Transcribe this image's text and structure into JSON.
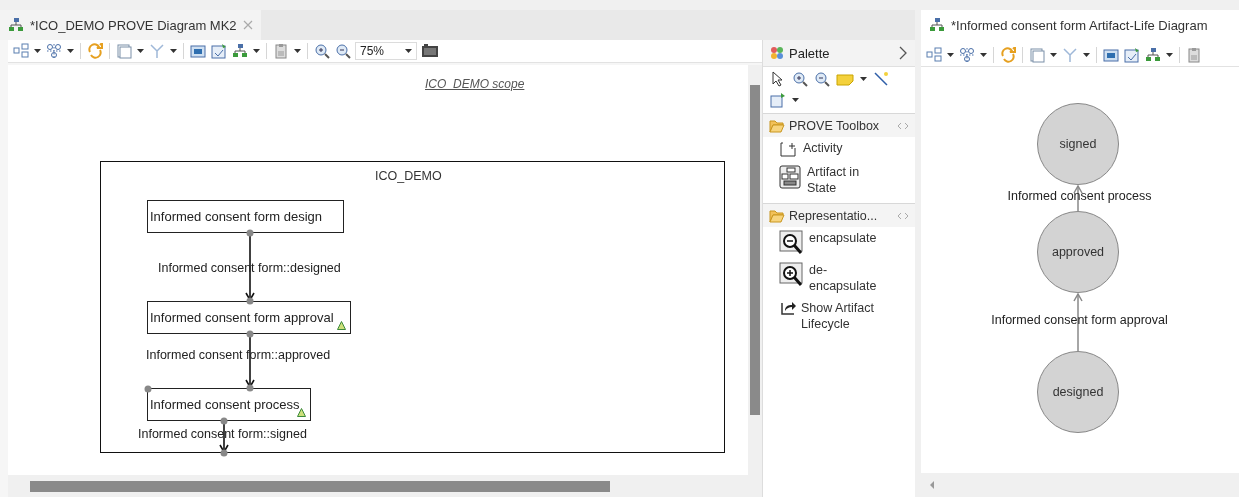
{
  "left_editor": {
    "tab": {
      "title": "*ICO_DEMO PROVE Diagram MK2",
      "closable": true
    },
    "zoom": "75%",
    "scope_label": "ICO_DEMO scope",
    "container": {
      "title": "ICO_DEMO"
    },
    "nodes": [
      {
        "label": "Informed consent form design",
        "badge": false
      },
      {
        "label": "Informed consent form approval",
        "badge": true
      },
      {
        "label": "Informed consent process",
        "badge": true
      }
    ],
    "edges": [
      {
        "label": "Informed consent form::designed"
      },
      {
        "label": "Informed consent form::approved"
      },
      {
        "label": "Informed consent form::signed"
      }
    ]
  },
  "palette": {
    "title": "Palette",
    "drawers": [
      {
        "title": "PROVE Toolbox",
        "expanded": true,
        "items": [
          {
            "kind": "activity",
            "label": "Activity"
          },
          {
            "kind": "artifact",
            "label": "Artifact in State"
          }
        ]
      },
      {
        "title": "Representatio...",
        "expanded": true,
        "items": [
          {
            "kind": "encapsulate",
            "label": "encapsulate"
          },
          {
            "kind": "decapsulate",
            "label": "de-encapsulate"
          },
          {
            "kind": "lifecycle",
            "label": "Show Artifact Lifecycle"
          }
        ]
      }
    ]
  },
  "right_editor": {
    "tab": {
      "title": "*Informed consent form Artifact-Life Diagram"
    },
    "states": [
      "signed",
      "approved",
      "designed"
    ],
    "transitions": [
      "Informed consent process",
      "Informed consent form approval"
    ]
  }
}
